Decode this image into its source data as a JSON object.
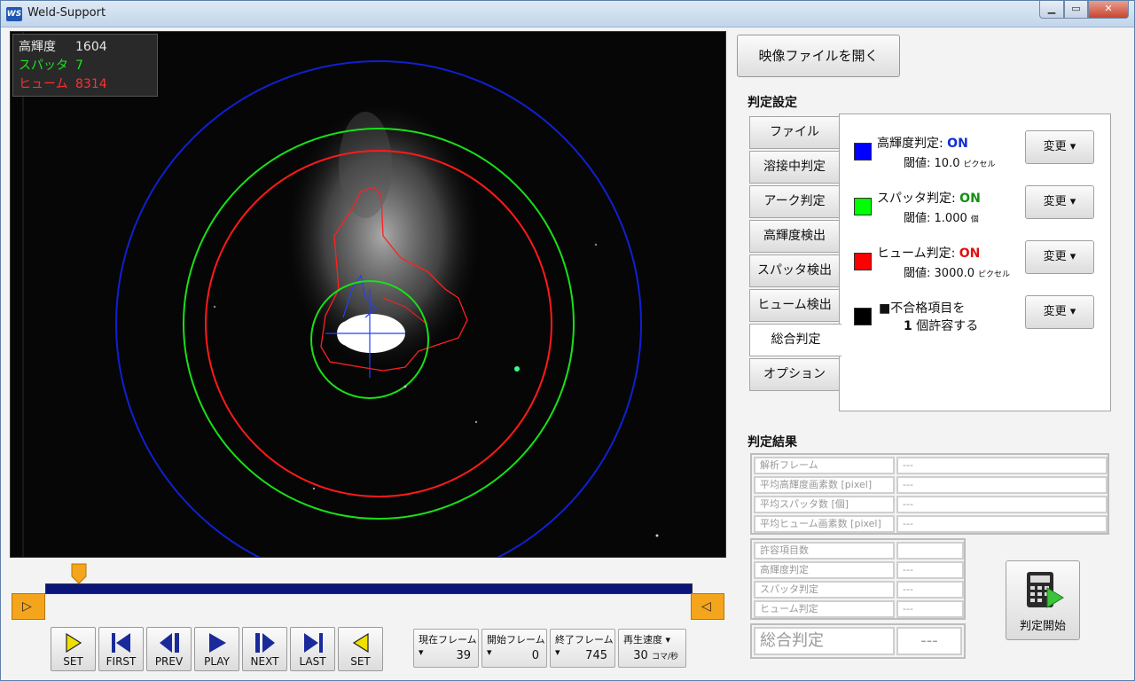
{
  "window": {
    "title": "Weld-Support",
    "app_icon_text": "WS",
    "minimize_glyph": "▁",
    "maximize_glyph": "▭",
    "close_glyph": "✕"
  },
  "overlay": {
    "rows": [
      {
        "label": "高輝度",
        "value": "1604"
      },
      {
        "label": "スパッタ",
        "value": "7"
      },
      {
        "label": "ヒューム",
        "value": "8314"
      }
    ]
  },
  "timeline": {
    "current_position": 0.052,
    "left_end_glyph": "▷",
    "right_end_glyph": "◁"
  },
  "controls": [
    {
      "label": "SET"
    },
    {
      "label": "FIRST"
    },
    {
      "label": "PREV"
    },
    {
      "label": "PLAY"
    },
    {
      "label": "NEXT"
    },
    {
      "label": "LAST"
    },
    {
      "label": "SET"
    }
  ],
  "frames": {
    "current": {
      "label": "現在フレーム ▾",
      "value": "39"
    },
    "start": {
      "label": "開始フレーム ▾",
      "value": "0"
    },
    "end": {
      "label": "終了フレーム ▾",
      "value": "745"
    },
    "speed": {
      "label": "再生速度 ▾",
      "value": "30",
      "unit": "コマ/秒"
    }
  },
  "open_file_button": "映像ファイルを開く",
  "settings": {
    "title": "判定設定",
    "tabs": [
      "ファイル",
      "溶接中判定",
      "アーク判定",
      "高輝度検出",
      "スパッタ検出",
      "ヒューム検出",
      "総合判定",
      "オプション"
    ],
    "active_tab": "総合判定",
    "items": [
      {
        "name": "高輝度判定: ",
        "state": "ON",
        "state_color": "#1030d0",
        "swatch": "#0000ff",
        "threshold_label": "閾値:",
        "threshold": "10.0",
        "unit": "ピクセル",
        "button": "変更 ▾"
      },
      {
        "name": "スパッタ判定: ",
        "state": "ON",
        "state_color": "#109010",
        "swatch": "#00ff00",
        "threshold_label": "閾値:",
        "threshold": "1.000",
        "unit": "個",
        "button": "変更 ▾"
      },
      {
        "name": "ヒューム判定: ",
        "state": "ON",
        "state_color": "#e01010",
        "swatch": "#ff0000",
        "threshold_label": "閾値:",
        "threshold": "3000.0",
        "unit": "ピクセル",
        "button": "変更 ▾"
      }
    ],
    "fail_item": {
      "line1": "■不合格項目を",
      "count": "1",
      "line2": "個許容する",
      "swatch": "#000000",
      "button": "変更 ▾"
    }
  },
  "results": {
    "title": "判定結果",
    "averages": [
      {
        "label": "解析フレーム",
        "value": "---"
      },
      {
        "label": "平均高輝度画素数 [pixel]",
        "value": "---"
      },
      {
        "label": "平均スパッタ数 [個]",
        "value": "---"
      },
      {
        "label": "平均ヒューム画素数 [pixel]",
        "value": "---"
      }
    ],
    "judgements": [
      {
        "label": "許容項目数",
        "value": ""
      },
      {
        "label": "高輝度判定",
        "value": "---"
      },
      {
        "label": "スパッタ判定",
        "value": "---"
      },
      {
        "label": "ヒューム判定",
        "value": "---"
      }
    ],
    "overall": {
      "label": "総合判定",
      "value": "---"
    }
  },
  "judge_start_button": "判定開始"
}
